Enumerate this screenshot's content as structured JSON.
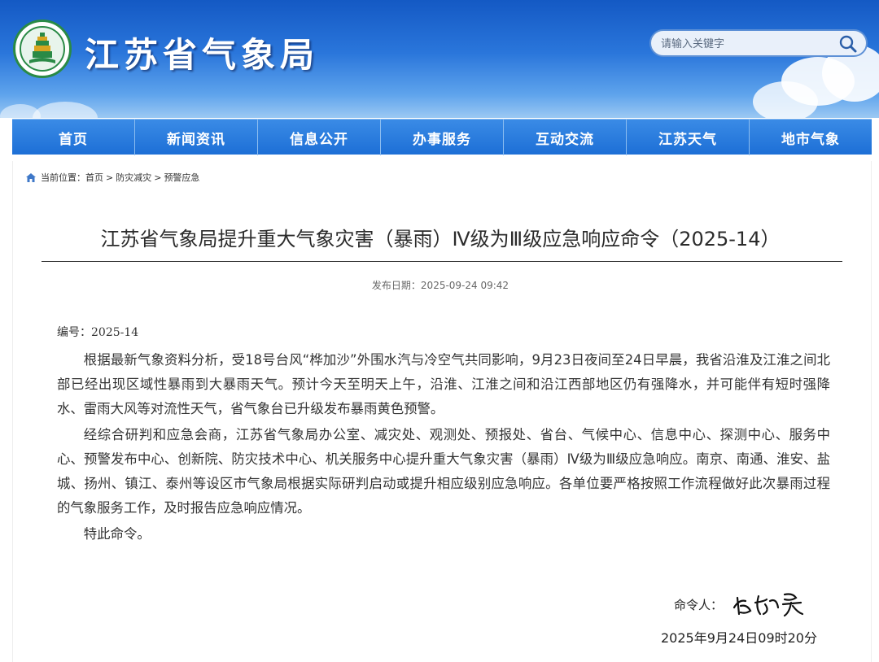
{
  "header": {
    "site_title": "江苏省气象局",
    "logo_icon": "jiangsu-meteorological-bureau-emblem",
    "search": {
      "placeholder": "请输入关键字",
      "icon": "search-icon"
    }
  },
  "nav": {
    "items": [
      {
        "label": "首页"
      },
      {
        "label": "新闻资讯"
      },
      {
        "label": "信息公开"
      },
      {
        "label": "办事服务"
      },
      {
        "label": "互动交流"
      },
      {
        "label": "江苏天气"
      },
      {
        "label": "地市气象"
      }
    ]
  },
  "breadcrumb": {
    "prefix": "当前位置：",
    "items": [
      "首页",
      "防灾减灾",
      "预警应急"
    ],
    "separator": ">"
  },
  "article": {
    "title": "江苏省气象局提升重大气象灾害（暴雨）Ⅳ级为Ⅲ级应急响应命令（2025-14）",
    "publish_date": "发布日期：2025-09-24 09:42",
    "doc_number": "编号：2025-14",
    "paragraphs": [
      "根据最新气象资料分析，受18号台风“桦加沙”外围水汽与冷空气共同影响，9月23日夜间至24日早晨，我省沿淮及江淮之间北部已经出现区域性暴雨到大暴雨天气。预计今天至明天上午，沿淮、江淮之间和沿江西部地区仍有强降水，并可能伴有短时强降水、雷雨大风等对流性天气，省气象台已升级发布暴雨黄色预警。",
      "经综合研判和应急会商，江苏省气象局办公室、减灾处、观测处、预报处、省台、气候中心、信息中心、探测中心、服务中心、预警发布中心、创新院、防灾技术中心、机关服务中心提升重大气象灾害（暴雨）Ⅳ级为Ⅲ级应急响应。南京、南通、淮安、盐城、扬州、镇江、泰州等设区市气象局根据实际研判启动或提升相应级别应急响应。各单位要严格按照工作流程做好此次暴雨过程的气象服务工作，及时报告应急响应情况。",
      "特此命令。"
    ],
    "signer_label": "命令人：",
    "signer_name": "唐红昇",
    "sign_time": "2025年9月24日09时20分"
  },
  "colors": {
    "header_blue": "#1459c4",
    "nav_blue": "#1d6fd6",
    "logo_green": "#2a8a46",
    "text": "#333333"
  }
}
